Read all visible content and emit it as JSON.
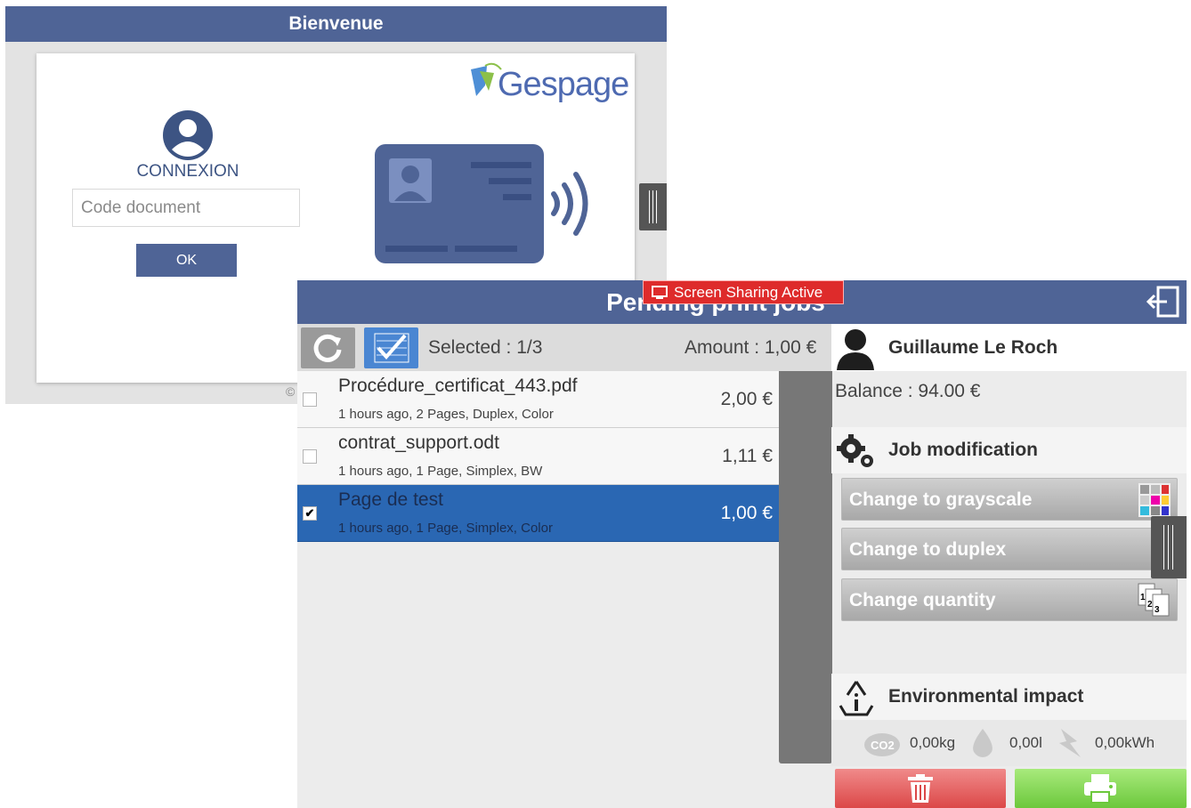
{
  "welcome_window": {
    "title": "Bienvenue",
    "connexion_label": "CONNEXION",
    "code_input": {
      "placeholder": "Code document",
      "value": ""
    },
    "ok_label": "OK",
    "logo_text": "Gespage",
    "copyright": "©"
  },
  "jobs_window": {
    "title": "Pending print jobs",
    "screen_sharing_badge": "Screen Sharing Active",
    "selected_text": "Selected : 1/3",
    "amount_text": "Amount : 1,00 €",
    "jobs": [
      {
        "name": "Procédure_certificat_443.pdf",
        "meta": "1 hours ago, 2 Pages, Duplex, Color",
        "price": "2,00 €",
        "checked": false
      },
      {
        "name": "contrat_support.odt",
        "meta": "1 hours ago, 1 Page, Simplex, BW",
        "price": "1,11 €",
        "checked": false
      },
      {
        "name": "Page de test",
        "meta": "1 hours ago, 1 Page, Simplex, Color",
        "price": "1,00 €",
        "checked": true
      }
    ],
    "user": {
      "name": "Guillaume Le Roch",
      "balance": "Balance : 94.00 €"
    },
    "job_modification": {
      "title": "Job modification",
      "buttons": [
        "Change to grayscale",
        "Change to duplex",
        "Change quantity"
      ]
    },
    "environmental": {
      "title": "Environmental impact",
      "co2": "0,00kg",
      "water": "0,00l",
      "energy": "0,00kWh"
    }
  },
  "colors": {
    "header_blue": "#4f6496",
    "selected_row": "#2a67b3",
    "delete_red": "#dc4848",
    "print_green": "#6cc83c",
    "badge_red": "#de2b2b"
  },
  "icons": [
    "user-circle-icon",
    "gespage-logo",
    "id-card-icon",
    "contactless-icon",
    "screen-share-icon",
    "logout-icon",
    "refresh-icon",
    "select-all-icon",
    "user-icon",
    "gears-icon",
    "color-palette-icon",
    "duplex-icon",
    "quantity-icon",
    "recycle-icon",
    "co2-icon",
    "water-drop-icon",
    "lightning-icon",
    "trash-icon",
    "printer-icon"
  ]
}
